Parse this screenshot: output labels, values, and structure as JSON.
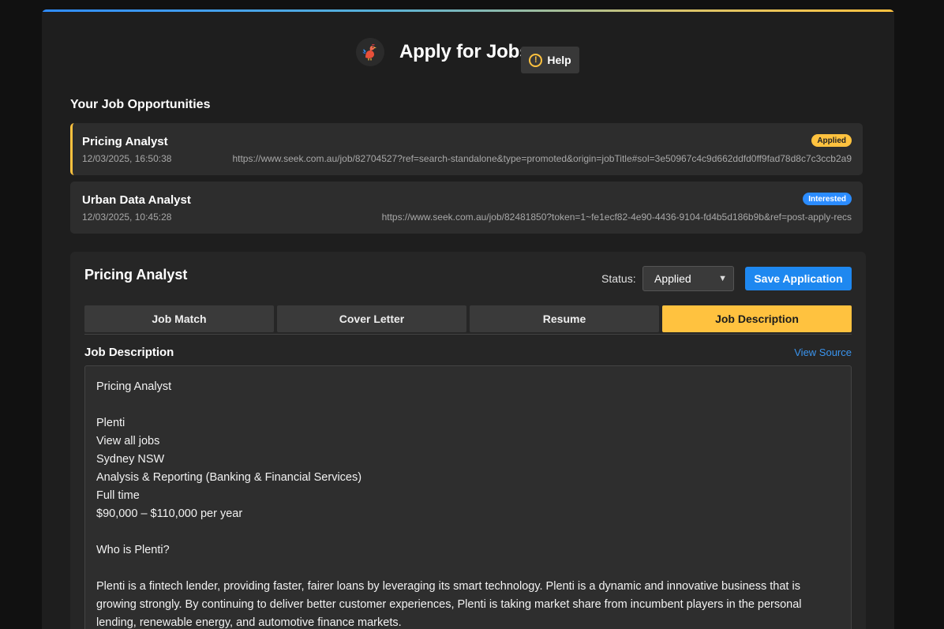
{
  "app": {
    "title": "Apply for Jobs",
    "help_label": "Help",
    "help_icon": "!"
  },
  "colors": {
    "accent": "#ffc23f",
    "primary": "#1e88f0",
    "background": "#1e1e1e"
  },
  "jobs": {
    "section_title": "Your Job Opportunities",
    "items": [
      {
        "title": "Pricing Analyst",
        "date": "12/03/2025, 16:50:38",
        "url": "https://www.seek.com.au/job/82704527?ref=search-standalone&type=promoted&origin=jobTitle#sol=3e50967c4c9d662ddfd0ff9fad78d8c7c3ccb2a9",
        "status": "Applied"
      },
      {
        "title": "Urban Data Analyst",
        "date": "12/03/2025, 10:45:28",
        "url": "https://www.seek.com.au/job/82481850?token=1~fe1ecf82-4e90-4436-9104-fd4b5d186b9b&ref=post-apply-recs",
        "status": "Interested"
      }
    ]
  },
  "detail": {
    "title": "Pricing Analyst",
    "status_label": "Status:",
    "status_value": "Applied",
    "save_label": "Save Application",
    "tabs": [
      {
        "label": "Job Match"
      },
      {
        "label": "Cover Letter"
      },
      {
        "label": "Resume"
      },
      {
        "label": "Job Description"
      }
    ],
    "active_tab": "Job Description",
    "section_heading": "Job Description",
    "view_source_label": "View Source",
    "description": "Pricing Analyst\n\nPlenti\nView all jobs\nSydney NSW\nAnalysis & Reporting (Banking & Financial Services)\nFull time\n$90,000 – $110,000 per year\n\nWho is Plenti?\n\nPlenti is a fintech lender, providing faster, fairer loans by leveraging its smart technology. Plenti is a dynamic and innovative business that is growing strongly. By continuing to deliver better customer experiences, Plenti is taking market share from incumbent players in the personal lending, renewable energy, and automotive finance markets."
  }
}
